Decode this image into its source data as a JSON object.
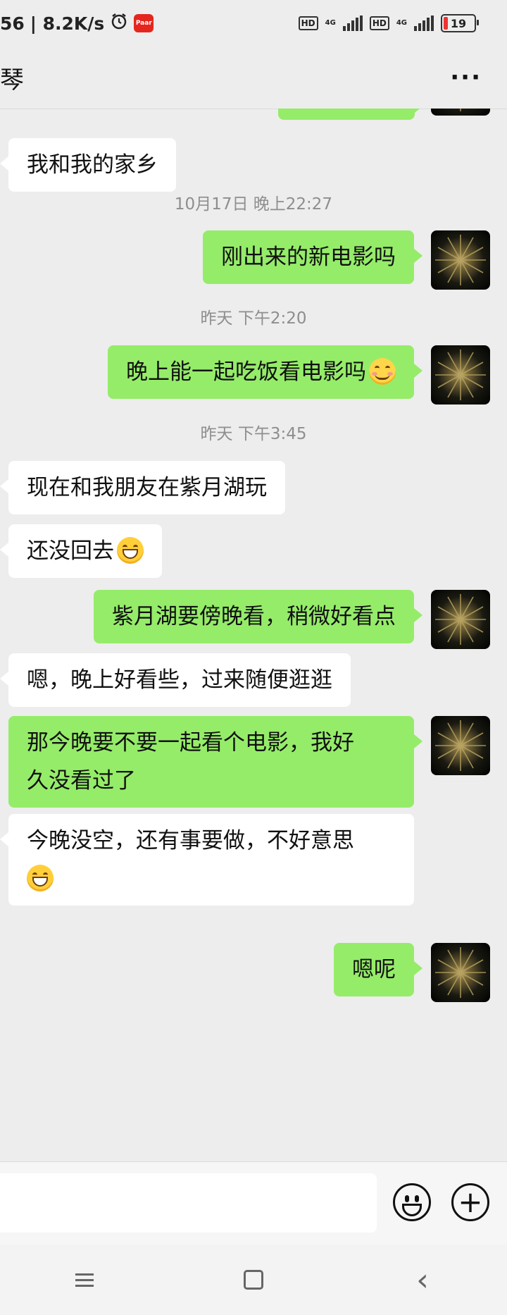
{
  "status_bar": {
    "time_fragment": "56",
    "speed": "| 8.2K/s",
    "alarm_icon": "alarm-clock-icon",
    "app_badge_label": "Paar",
    "hd1": "HD",
    "net1": "4G",
    "hd2": "HD",
    "net2": "4G",
    "battery_level": "19"
  },
  "header": {
    "title": "琴",
    "more_label": "···"
  },
  "messages": [
    {
      "type": "in",
      "text": "我和我的家乡"
    },
    {
      "type": "time",
      "text": "10月17日 晚上22:27"
    },
    {
      "type": "out",
      "text": "刚出来的新电影吗"
    },
    {
      "type": "time",
      "text": "昨天 下午2:20"
    },
    {
      "type": "out",
      "text": "晚上能一起吃饭看电影吗",
      "emoji": "blush-smile"
    },
    {
      "type": "time",
      "text": "昨天 下午3:45"
    },
    {
      "type": "in",
      "text": "现在和我朋友在紫月湖玩"
    },
    {
      "type": "in",
      "text": "还没回去",
      "emoji": "grin"
    },
    {
      "type": "out",
      "text": "紫月湖要傍晚看，稍微好看点"
    },
    {
      "type": "in",
      "text": "嗯，晚上好看些，过来随便逛逛"
    },
    {
      "type": "out",
      "line1": "那今晚要不要一起看个电影，我好",
      "line2": "久没看过了"
    },
    {
      "type": "in",
      "line1": "今晚没空，还有事要做，不好意思",
      "emoji": "grin"
    },
    {
      "type": "out",
      "text": "嗯呢"
    }
  ],
  "input_bar": {
    "placeholder": "",
    "emoji_button_icon": "emoji-icon",
    "plus_button_label": "+"
  },
  "nav_bar": {
    "menu_icon": "menu-icon",
    "home_icon": "home-icon",
    "back_label": "‹"
  },
  "colors": {
    "background": "#ededed",
    "incoming_bubble": "#ffffff",
    "outgoing_bubble": "#95ec69",
    "timestamp_text": "#8e8e8e"
  }
}
